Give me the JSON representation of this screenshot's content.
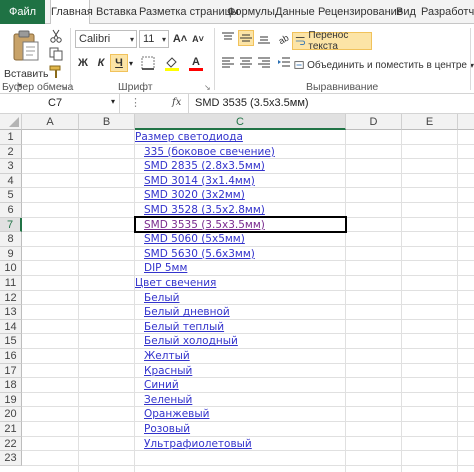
{
  "tabs": [
    "Файл",
    "Главная",
    "Вставка",
    "Разметка страницы",
    "Формулы",
    "Данные",
    "Рецензирование",
    "Вид",
    "Разработчик"
  ],
  "ribbon": {
    "paste_label": "Вставить",
    "font_name": "Calibri",
    "font_size": "11",
    "grow_font": "A˄",
    "shrink_font": "A˅",
    "bold": "Ж",
    "italic": "К",
    "underline": "Ч",
    "font_color_glyph": "A",
    "wrap_text": "Перенос текста",
    "merge_center": "Объединить и поместить в центре",
    "groups": {
      "clipboard": "Буфер обмена",
      "font": "Шрифт",
      "alignment": "Выравнивание"
    },
    "accent": "#1f7244",
    "highlight": "#fce4a6"
  },
  "formula_bar": {
    "name_box": "C7",
    "fx": "fx",
    "value": "SMD 3535 (3.5x3.5мм)"
  },
  "sheet": {
    "columns": [
      "A",
      "B",
      "C",
      "D",
      "E"
    ],
    "selected_column": "C",
    "selected_row": 7,
    "rows": [
      {
        "n": "1",
        "text": "Размер светодиода",
        "indent": false,
        "visited": false
      },
      {
        "n": "2",
        "text": "335 (боковое свечение)",
        "indent": true,
        "visited": false
      },
      {
        "n": "3",
        "text": "SMD 2835 (2.8x3.5мм)",
        "indent": true,
        "visited": false
      },
      {
        "n": "4",
        "text": "SMD 3014 (3x1.4мм)",
        "indent": true,
        "visited": false
      },
      {
        "n": "5",
        "text": "SMD 3020 (3x2мм)",
        "indent": true,
        "visited": false
      },
      {
        "n": "6",
        "text": "SMD 3528 (3.5x2.8мм)",
        "indent": true,
        "visited": false
      },
      {
        "n": "7",
        "text": "SMD 3535 (3.5x3.5мм)",
        "indent": true,
        "visited": true
      },
      {
        "n": "8",
        "text": "SMD 5060 (5x5мм)",
        "indent": true,
        "visited": false
      },
      {
        "n": "9",
        "text": "SMD 5630 (5.6x3мм)",
        "indent": true,
        "visited": false
      },
      {
        "n": "10",
        "text": "DIP 5мм",
        "indent": true,
        "visited": false
      },
      {
        "n": "11",
        "text": "Цвет свечения",
        "indent": false,
        "visited": false
      },
      {
        "n": "12",
        "text": "Белый",
        "indent": true,
        "visited": false
      },
      {
        "n": "13",
        "text": "Белый дневной",
        "indent": true,
        "visited": false
      },
      {
        "n": "14",
        "text": "Белый теплый",
        "indent": true,
        "visited": false
      },
      {
        "n": "15",
        "text": "Белый холодный",
        "indent": true,
        "visited": false
      },
      {
        "n": "16",
        "text": "Желтый",
        "indent": true,
        "visited": false
      },
      {
        "n": "17",
        "text": "Красный",
        "indent": true,
        "visited": false
      },
      {
        "n": "18",
        "text": "Синий",
        "indent": true,
        "visited": false
      },
      {
        "n": "19",
        "text": "Зеленый",
        "indent": true,
        "visited": false
      },
      {
        "n": "20",
        "text": "Оранжевый",
        "indent": true,
        "visited": false
      },
      {
        "n": "21",
        "text": "Розовый",
        "indent": true,
        "visited": false
      },
      {
        "n": "22",
        "text": "Ультрафиолетовый",
        "indent": true,
        "visited": false
      },
      {
        "n": "23",
        "text": "",
        "indent": false,
        "visited": false
      }
    ]
  }
}
